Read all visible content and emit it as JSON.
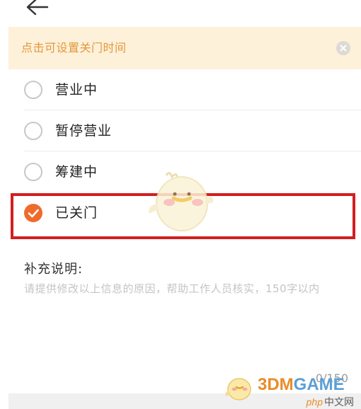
{
  "header": {
    "back_icon": "arrow-left-icon"
  },
  "banner": {
    "text": "点击可设置关门时间",
    "close_icon": "close-circle-icon",
    "background": "#fdf1da",
    "text_color": "#e3973a"
  },
  "status_options": [
    {
      "label": "营业中",
      "checked": false
    },
    {
      "label": "暂停营业",
      "checked": false
    },
    {
      "label": "筹建中",
      "checked": false
    },
    {
      "label": "已关门",
      "checked": true
    }
  ],
  "accent_color": "#ee6b2c",
  "highlight_color": "#d21f1f",
  "note": {
    "title": "补充说明:",
    "placeholder": "请提供修改以上信息的原因，帮助工作人员核实，150字以内",
    "counter": "0/150"
  },
  "watermark": {
    "brand_prefix": "3DM",
    "brand_suffix": "GAME",
    "site_prefix": "php",
    "site_suffix": "中文网"
  }
}
